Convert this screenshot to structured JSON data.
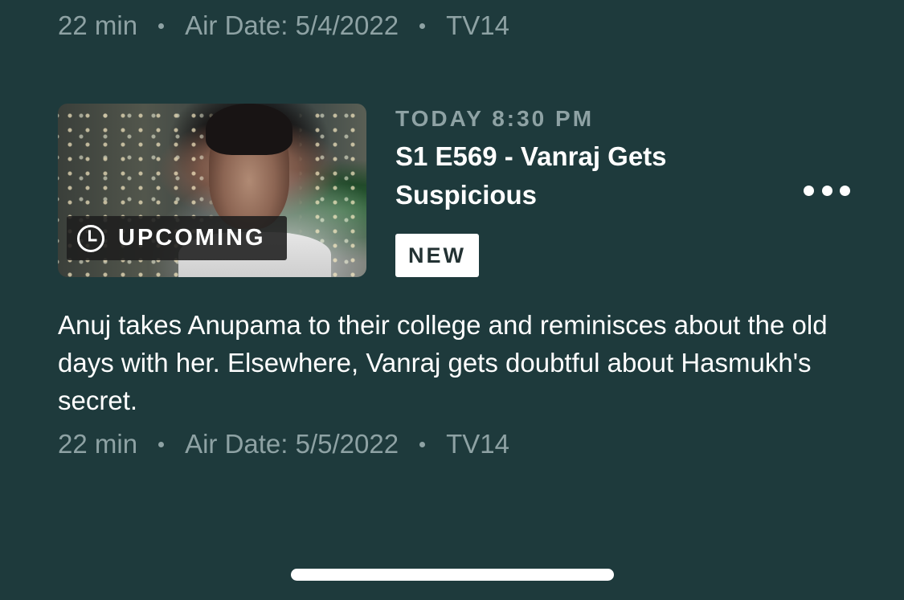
{
  "previous_episode": {
    "duration": "22 min",
    "air_date": "Air Date: 5/4/2022",
    "rating": "TV14"
  },
  "episode": {
    "badge_label": "UPCOMING",
    "badge_icon": "clock-icon",
    "air_time": "TODAY 8:30 PM",
    "title": "S1 E569 - Vanraj Gets Suspicious",
    "new_label": "NEW",
    "description": "Anuj takes Anupama to their college and reminisces about the old days with her. Elsewhere, Vanraj gets doubtful about Hasmukh's secret.",
    "duration": "22 min",
    "air_date": "Air Date: 5/5/2022",
    "rating": "TV14",
    "more_icon": "more-options-icon"
  },
  "colors": {
    "background": "#1e3a3c",
    "muted_text": "#8ea2a4",
    "primary_text": "#ffffff",
    "badge_background": "#1e1e1e"
  }
}
